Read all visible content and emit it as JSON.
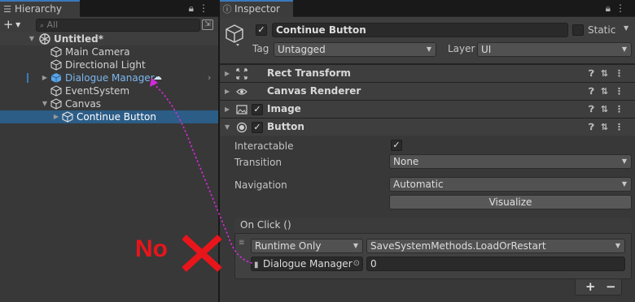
{
  "hierarchy": {
    "tab_label": "Hierarchy",
    "search_placeholder": "All",
    "scene_name": "Untitled*",
    "items": [
      {
        "label": "Main Camera",
        "icon": "gameobject-icon"
      },
      {
        "label": "Directional Light",
        "icon": "gameobject-icon"
      },
      {
        "label": "Dialogue Manager",
        "icon": "prefab-icon",
        "prefab": true
      },
      {
        "label": "EventSystem",
        "icon": "gameobject-icon"
      },
      {
        "label": "Canvas",
        "icon": "gameobject-icon"
      },
      {
        "label": "Continue Button",
        "icon": "gameobject-icon",
        "selected": true
      }
    ]
  },
  "inspector": {
    "tab_label": "Inspector",
    "object_name": "Continue Button",
    "static_label": "Static",
    "tag_label": "Tag",
    "tag_value": "Untagged",
    "layer_label": "Layer",
    "layer_value": "UI",
    "components": [
      {
        "title": "Rect Transform",
        "icon": "rect-transform-icon"
      },
      {
        "title": "Canvas Renderer",
        "icon": "eye-icon"
      },
      {
        "title": "Image",
        "icon": "image-icon"
      },
      {
        "title": "Button",
        "icon": "button-icon"
      }
    ],
    "button_props": {
      "interactable_label": "Interactable",
      "transition_label": "Transition",
      "transition_value": "None",
      "navigation_label": "Navigation",
      "navigation_value": "Automatic",
      "visualize_label": "Visualize"
    },
    "on_click": {
      "title": "On Click ()",
      "runtime_value": "Runtime Only",
      "function_value": "SaveSystemMethods.LoadOrRestart",
      "target_object": "Dialogue Manager",
      "argument_value": "0",
      "add_label": "+",
      "remove_label": "−"
    }
  },
  "annotation": {
    "text": "No",
    "color": "#e8151b",
    "arrow_color": "#d42ad8"
  },
  "colors": {
    "selection": "#2c5d87",
    "prefab_text": "#7cb7ee",
    "accent_tab": "#3a79bb"
  }
}
